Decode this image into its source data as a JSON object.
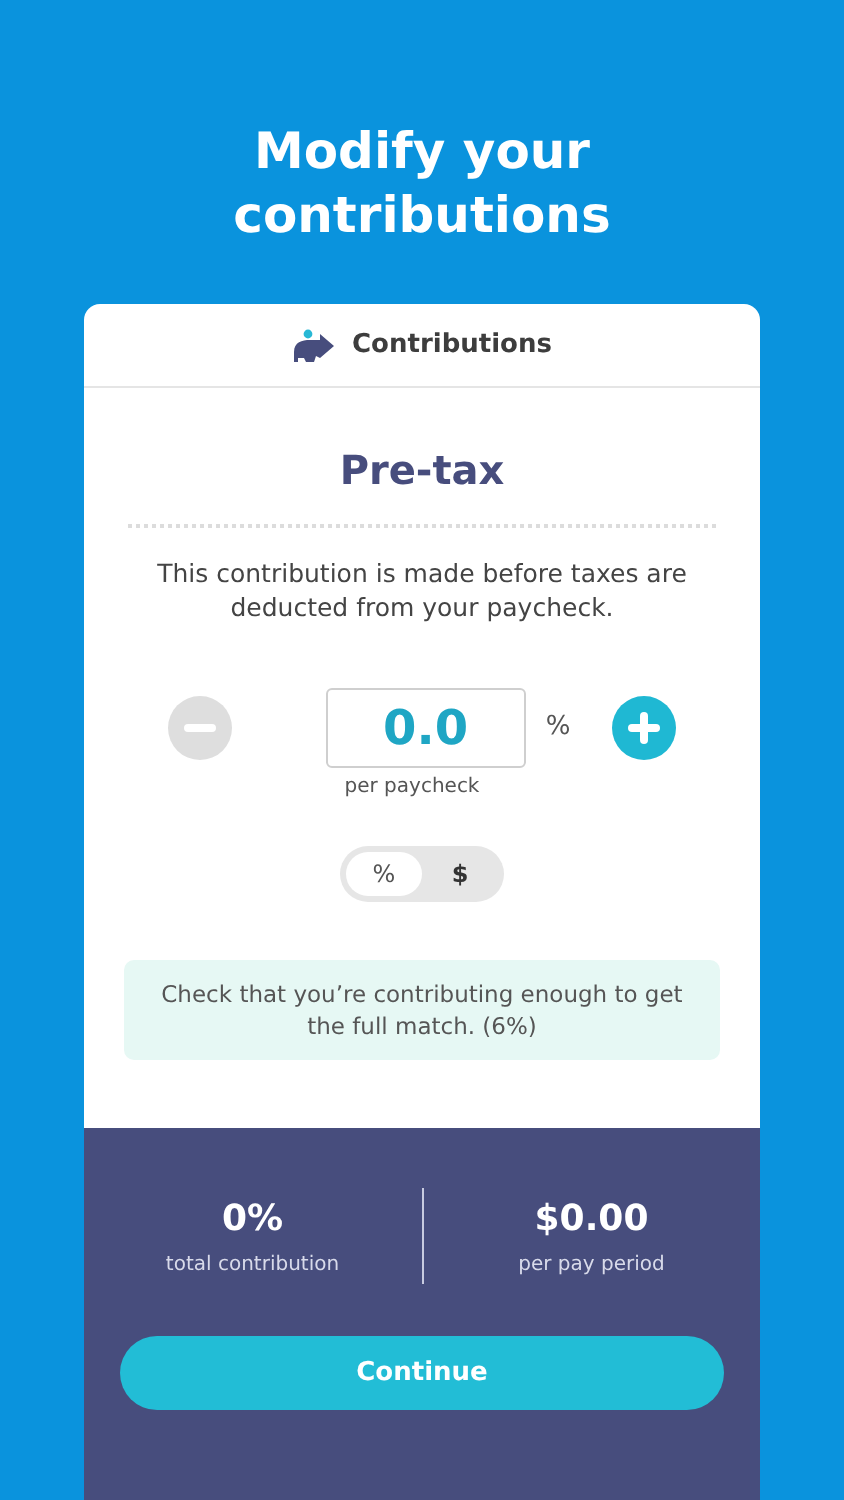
{
  "headline": "Modify your contributions",
  "card": {
    "title": "Contributions",
    "section_title": "Pre-tax",
    "description": "This contribution is made before taxes are deducted from your paycheck.",
    "decrease": {
      "disabled": true
    },
    "increase": {
      "disabled": false
    },
    "amount": {
      "value": "0.0",
      "unit": "%",
      "caption": "per paycheck"
    },
    "unit_toggle": [
      {
        "label": "%",
        "selected": true
      },
      {
        "label": "$",
        "selected": false
      }
    ],
    "note": "Check that you’re contributing enough to get the full match. (6%)"
  },
  "summary": [
    {
      "value": "0%",
      "label": "total contribution"
    },
    {
      "value": "$0.00",
      "label": "per pay period"
    }
  ],
  "primary_button": "Continue"
}
